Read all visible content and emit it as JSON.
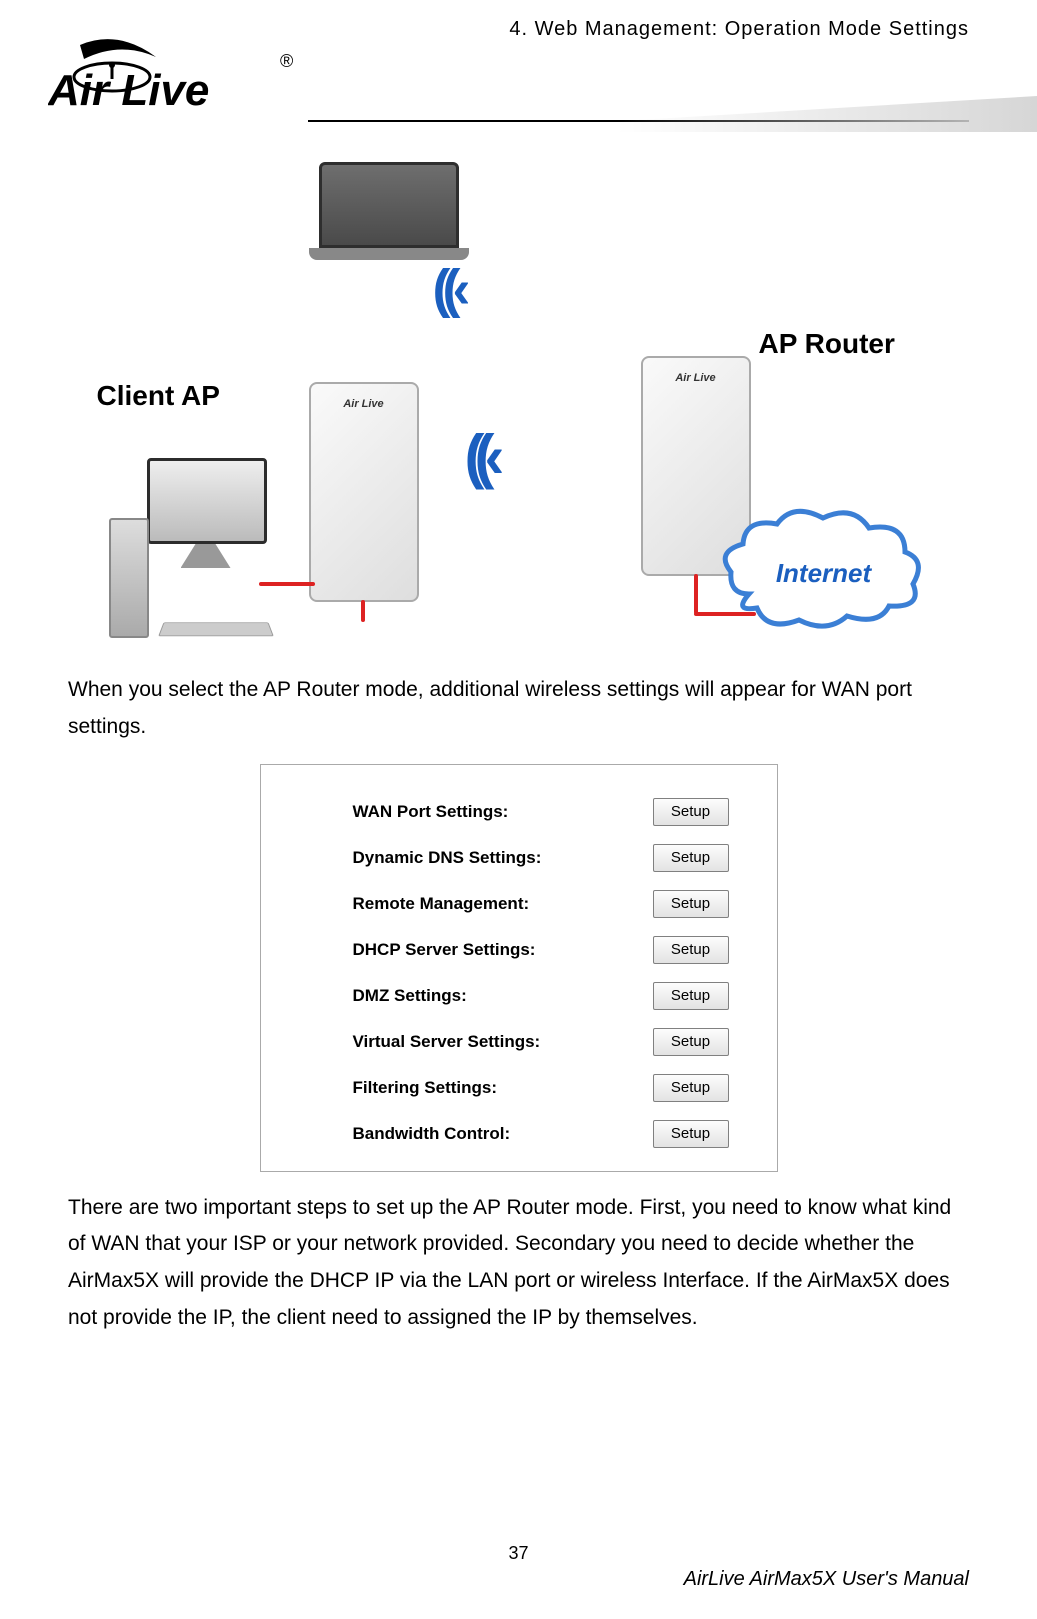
{
  "header": {
    "chapter": "4. Web Management: Operation Mode Settings",
    "logo_text_main": "Air Live",
    "logo_registered": "®"
  },
  "diagram": {
    "client_ap_label": "Client AP",
    "ap_router_label": "AP Router",
    "internet_label": "Internet",
    "unit_brand": "Air Live"
  },
  "paragraph1": "When you select the AP Router mode, additional wireless settings will appear for WAN port settings.",
  "settings": [
    {
      "label": "WAN Port Settings:",
      "button": "Setup"
    },
    {
      "label": "Dynamic DNS Settings:",
      "button": "Setup"
    },
    {
      "label": "Remote Management:",
      "button": "Setup"
    },
    {
      "label": "DHCP Server Settings:",
      "button": "Setup"
    },
    {
      "label": "DMZ Settings:",
      "button": "Setup"
    },
    {
      "label": "Virtual Server Settings:",
      "button": "Setup"
    },
    {
      "label": "Filtering Settings:",
      "button": "Setup"
    },
    {
      "label": "Bandwidth Control:",
      "button": "Setup"
    }
  ],
  "paragraph2": "There are two important steps to set up the AP Router mode. First, you need to know what kind of WAN that your ISP or your network provided. Secondary you need to decide whether the AirMax5X will provide the DHCP IP via the LAN port or wireless Interface. If the AirMax5X does not provide the IP, the client need to assigned the IP by themselves.",
  "footer": {
    "page_number": "37",
    "manual": "AirLive AirMax5X User's Manual"
  }
}
